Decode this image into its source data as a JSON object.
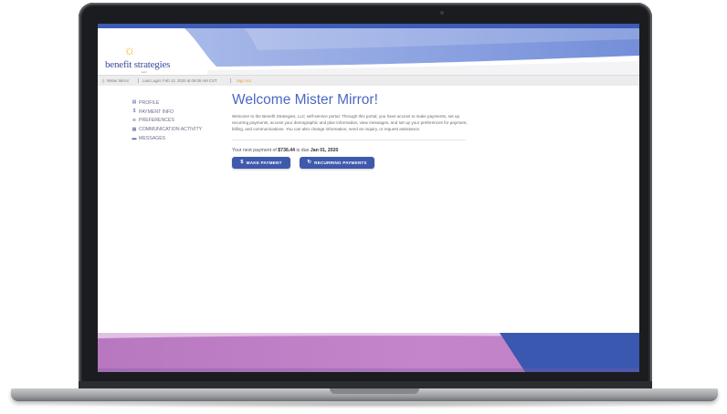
{
  "header": {
    "logo_text": "benefit strategies",
    "logo_sub": "LLC"
  },
  "userbar": {
    "user_name": "Mister Mirror",
    "last_login": "Last Login: Feb 12, 2020 at 09:06 AM CST",
    "sign_out": "Sign out"
  },
  "nav": {
    "items": [
      {
        "label": "PROFILE",
        "icon": "id-card-icon"
      },
      {
        "label": "PAYMENT INFO",
        "icon": "dollar-icon"
      },
      {
        "label": "PREFERENCES",
        "icon": "sliders-icon"
      },
      {
        "label": "COMMUNICATION ACTIVITY",
        "icon": "chat-icon"
      },
      {
        "label": "MESSAGES",
        "icon": "message-icon"
      }
    ]
  },
  "main": {
    "title": "Welcome Mister Mirror!",
    "welcome_text": "Welcome to the Benefit Strategies, LLC self-service portal. Through this portal, you have access to make payments, set up recurring payments, access your demographic and plan information, view messages, and set up your preferences for payment, billing, and communications. You can also change information, send an inquiry, or request assistance.",
    "next_payment_prefix": "Your next payment of",
    "next_payment_amount": "$736.44",
    "next_payment_mid": "is due",
    "next_payment_date": "Jan 01, 2020",
    "make_payment_label": "MAKE PAYMENT",
    "recurring_label": "RECURRING PAYMENTS"
  },
  "colors": {
    "brand_blue": "#3f59ad",
    "title_blue": "#4b68c2",
    "footer_purple": "#c17fc6",
    "sign_out_orange": "#e59b3b"
  }
}
